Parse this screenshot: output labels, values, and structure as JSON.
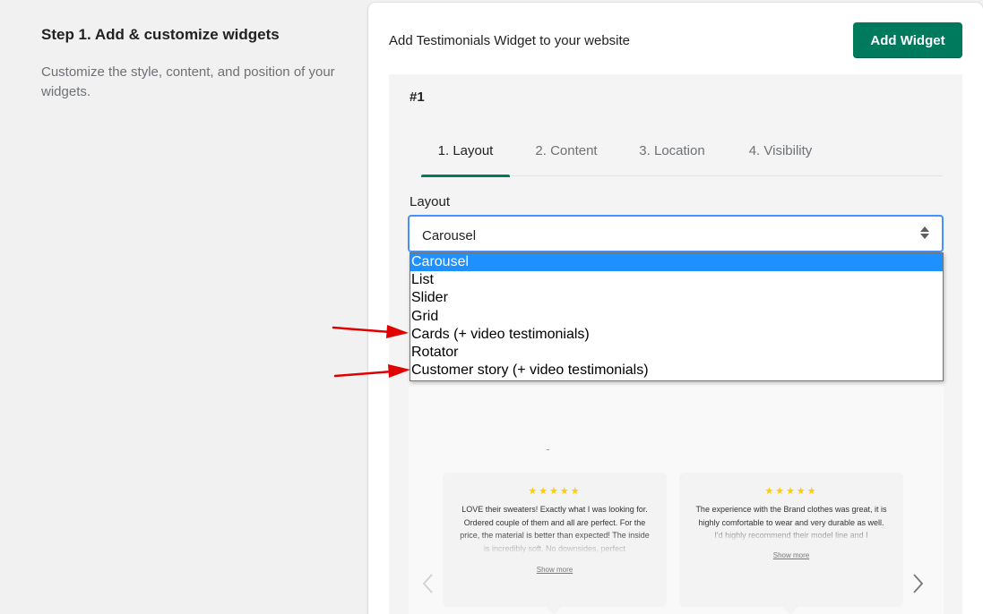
{
  "step": {
    "title": "Step 1. Add & customize widgets",
    "description": "Customize the style, content, and position of your widgets."
  },
  "card": {
    "header": "Add Testimonials Widget to your website",
    "add_button": "Add Widget"
  },
  "widget": {
    "number": "#1",
    "tabs": [
      {
        "label": "1. Layout",
        "active": true
      },
      {
        "label": "2. Content",
        "active": false
      },
      {
        "label": "3. Location",
        "active": false
      },
      {
        "label": "4. Visibility",
        "active": false
      }
    ],
    "layout_label": "Layout",
    "layout_value": "Carousel",
    "layout_options": [
      "Carousel",
      "List",
      "Slider",
      "Grid",
      "Cards (+ video testimonials)",
      "Rotator",
      "Customer story (+ video testimonials)"
    ]
  },
  "preview": {
    "reviews": [
      {
        "stars": "★★★★★",
        "text": "LOVE their sweaters! Exactly what I was looking for. Ordered couple of them and all are perfect. For the price, the material is better than expected! The inside is incredibly soft. No downsides, perfect",
        "show_more": "Show more"
      },
      {
        "stars": "★★★★★",
        "text": "The experience with the Brand clothes was great, it is highly comfortable to wear and very durable as well. I'd highly recommend their model line and I",
        "show_more": "Show more"
      }
    ]
  },
  "colors": {
    "accent": "#007a5c",
    "focus": "#458fff",
    "selected_option": "#1e90ff",
    "annotation_arrow": "#e00000",
    "stars": "#ffcc00"
  },
  "icons": [
    "select-arrows-icon",
    "chevron-left-icon",
    "chevron-right-icon",
    "red-arrow-annotation"
  ]
}
